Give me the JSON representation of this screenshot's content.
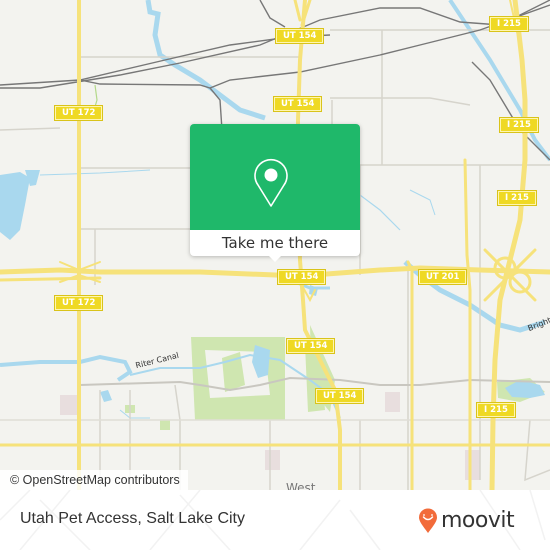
{
  "map": {
    "shields": [
      {
        "id": "ut154-top",
        "label": "UT 154"
      },
      {
        "id": "ut154-2",
        "label": "UT 154"
      },
      {
        "id": "i215-top",
        "label": "I 215"
      },
      {
        "id": "i215-2",
        "label": "I 215"
      },
      {
        "id": "i215-3",
        "label": "I 215"
      },
      {
        "id": "ut172-top",
        "label": "UT 172"
      },
      {
        "id": "ut172-bottom",
        "label": "UT 172"
      },
      {
        "id": "ut154-mid",
        "label": "UT 154"
      },
      {
        "id": "ut201",
        "label": "UT 201"
      },
      {
        "id": "ut154-south",
        "label": "UT 154"
      },
      {
        "id": "ut154-south2",
        "label": "UT 154"
      },
      {
        "id": "i215-south",
        "label": "I 215"
      }
    ],
    "labels": {
      "riter_canal": "Riter Canal",
      "brighton": "Brighton",
      "west": "West"
    },
    "colors": {
      "land": "#f3f3ef",
      "water": "#a9d8ee",
      "park": "#cfe6b0",
      "highway": "#f6e27a",
      "minor_road": "#d6d4cc",
      "rail": "#777777"
    }
  },
  "popup": {
    "action_label": "Take me there",
    "icon": "map-pin-icon",
    "accent": "#1fb86a"
  },
  "attribution": "© OpenStreetMap contributors",
  "footer": {
    "place": "Utah Pet Access, Salt Lake City",
    "brand": "moovit",
    "brand_color": "#f26b3a"
  }
}
